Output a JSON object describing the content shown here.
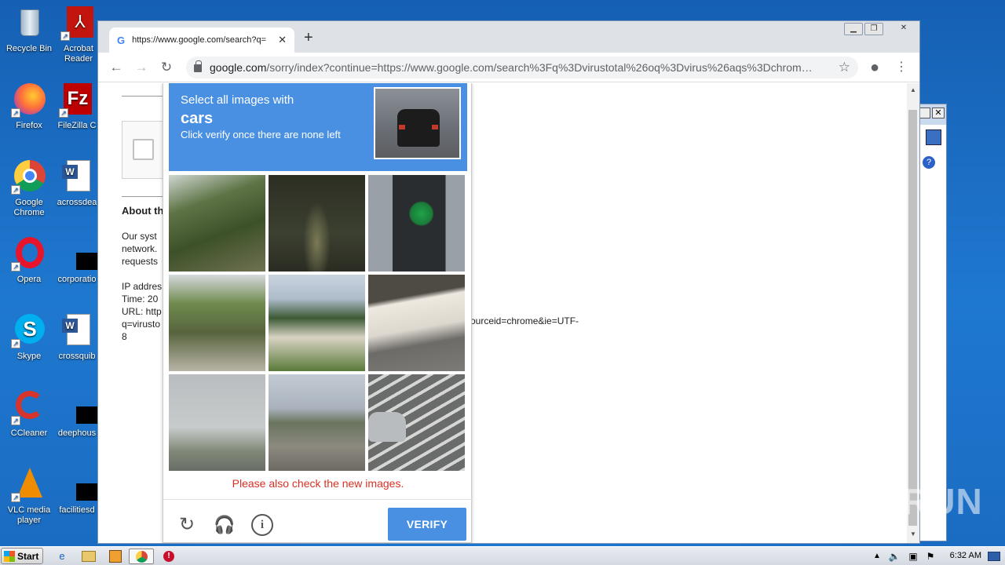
{
  "desktop": {
    "icons": [
      {
        "label": "Recycle Bin",
        "icon": "recycle-bin-icon"
      },
      {
        "label": "Acrobat Reader",
        "icon": "acrobat-icon"
      },
      {
        "label": "Firefox",
        "icon": "firefox-icon"
      },
      {
        "label": "FileZilla C",
        "icon": "filezilla-icon"
      },
      {
        "label": "Google Chrome",
        "icon": "chrome-icon"
      },
      {
        "label": "acrossdea",
        "icon": "word-doc-icon"
      },
      {
        "label": "Opera",
        "icon": "opera-icon"
      },
      {
        "label": "corporatio",
        "icon": "black-file-icon"
      },
      {
        "label": "Skype",
        "icon": "skype-icon"
      },
      {
        "label": "crossquib",
        "icon": "word-doc-icon"
      },
      {
        "label": "CCleaner",
        "icon": "ccleaner-icon"
      },
      {
        "label": "deephous",
        "icon": "black-file-icon"
      },
      {
        "label": "VLC media player",
        "icon": "vlc-icon"
      },
      {
        "label": "facilitiesd",
        "icon": "black-file-icon"
      }
    ]
  },
  "browser": {
    "tab_title": "https://www.google.com/search?q=",
    "tab_close": "✕",
    "new_tab": "+",
    "url_domain": "google.com",
    "url_rest": "/sorry/index?continue=https://www.google.com/search%3Fq%3Dvirustotal%26oq%3Dvirus%26aqs%3Dchrom…"
  },
  "page": {
    "about_heading": "About th",
    "para1": [
      "Our syst",
      "network.",
      "requests"
    ],
    "para2": [
      "IP addres",
      "Time: 20",
      "URL: http",
      "q=virusto",
      "8"
    ],
    "right_text": "ourceid=chrome&ie=UTF-"
  },
  "recaptcha": {
    "instruction_line1": "Select all images with",
    "target": "cars",
    "instruction_line3": "Click verify once there are none left",
    "tiles": [
      {
        "desc": "trees"
      },
      {
        "desc": "dark trees"
      },
      {
        "desc": "traffic light"
      },
      {
        "desc": "palm street"
      },
      {
        "desc": "street pole house"
      },
      {
        "desc": "overpass road"
      },
      {
        "desc": "palm trees sky"
      },
      {
        "desc": "bridge road"
      },
      {
        "desc": "car crosswalk"
      }
    ],
    "error_message": "Please also check the new images.",
    "verify_label": "VERIFY",
    "accent": "#4a90e2"
  },
  "taskbar": {
    "start_label": "Start",
    "clock": "6:32 AM"
  },
  "watermark": "ANY RUN"
}
